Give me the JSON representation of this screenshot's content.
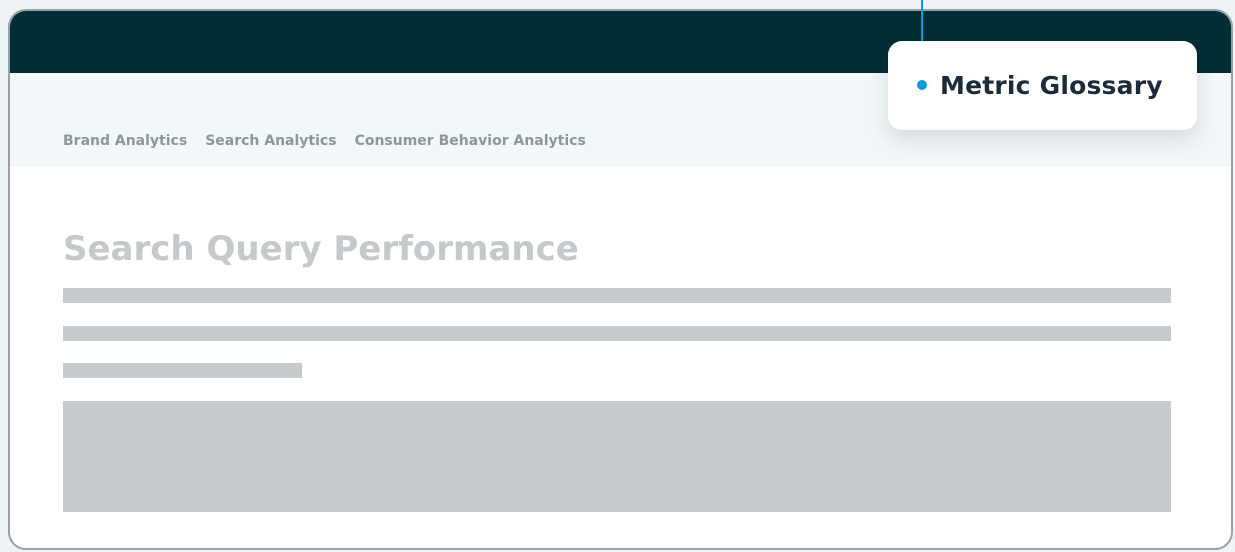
{
  "nav": {
    "items": [
      {
        "label": "Brand Analytics"
      },
      {
        "label": "Search Analytics"
      },
      {
        "label": "Consumer Behavior Analytics"
      }
    ]
  },
  "main": {
    "title": "Search Query Performance"
  },
  "callout": {
    "label": "Metric Glossary",
    "accent_color": "#0a9bd6"
  },
  "colors": {
    "header_bg": "#032d36",
    "subnav_bg": "#f2f8f9",
    "skeleton": "#c8cbce"
  }
}
